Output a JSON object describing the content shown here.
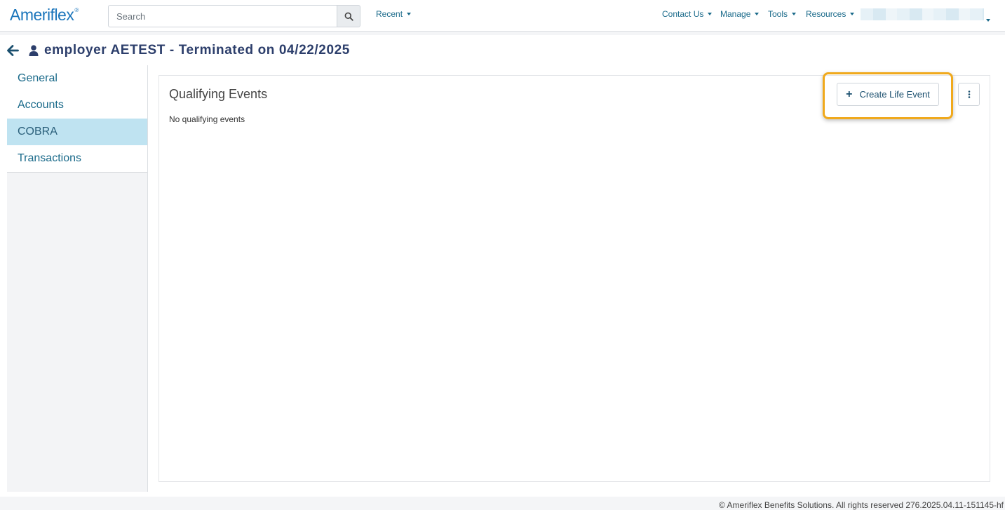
{
  "brand": {
    "logo_text": "Ameriflex",
    "logo_mark": "®"
  },
  "search": {
    "placeholder": "Search"
  },
  "nav": {
    "recent": "Recent",
    "contact_us": "Contact Us",
    "manage": "Manage",
    "tools": "Tools",
    "resources": "Resources"
  },
  "header": {
    "title": "employer AETEST - Terminated on 04/22/2025"
  },
  "sidebar": {
    "items": [
      {
        "label": "General"
      },
      {
        "label": "Accounts"
      },
      {
        "label": "COBRA"
      },
      {
        "label": "Transactions"
      }
    ]
  },
  "content": {
    "title": "Qualifying Events",
    "empty_message": "No qualifying events",
    "create_button": "Create Life Event"
  },
  "footer": {
    "text": "© Ameriflex Benefits Solutions. All rights reserved 276.2025.04.11-151145-hf"
  },
  "colors": {
    "accent": "#1a6a8a",
    "active_bg": "#bfe3f1",
    "highlight": "#f0a91c",
    "title": "#2c3e6b"
  }
}
